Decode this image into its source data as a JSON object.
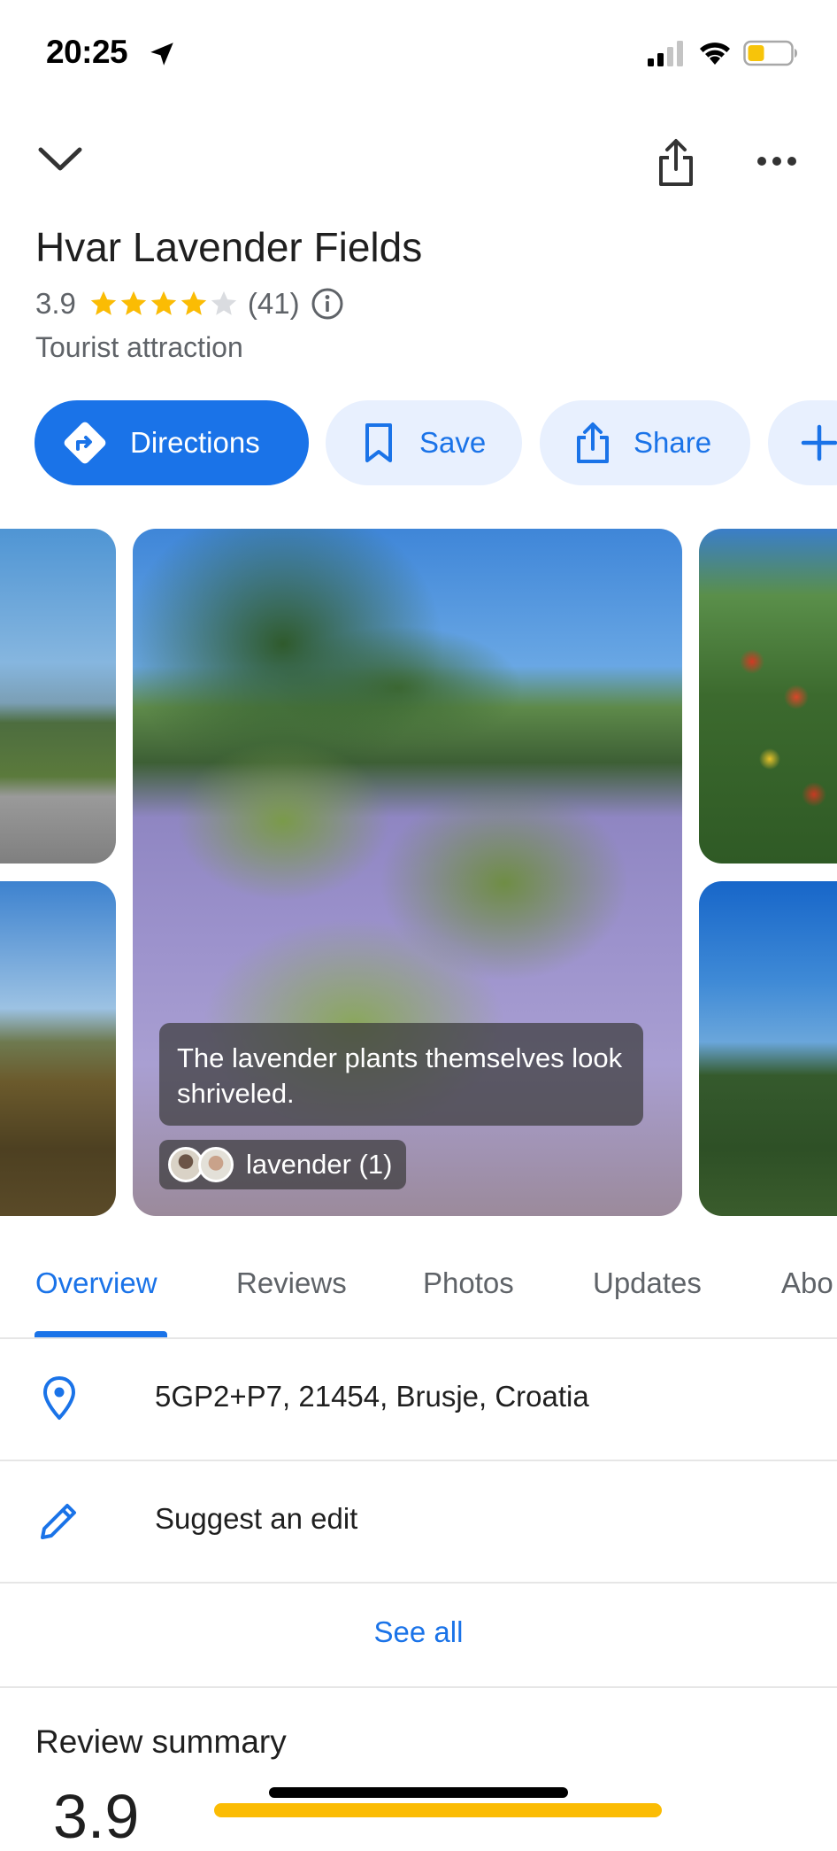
{
  "status_bar": {
    "time": "20:25"
  },
  "header": {
    "collapse_icon": "chevron-down-icon",
    "share_icon": "share-icon",
    "more_icon": "more-horizontal-icon"
  },
  "place": {
    "title": "Hvar Lavender Fields",
    "rating": "3.9",
    "rating_value": 3.9,
    "review_count": "(41)",
    "category": "Tourist attraction"
  },
  "actions": {
    "directions": "Directions",
    "save": "Save",
    "share": "Share"
  },
  "photos": {
    "caption": "The lavender plants themselves look shriveled.",
    "tag": "lavender (1)"
  },
  "tabs": [
    {
      "label": "Overview",
      "active": true
    },
    {
      "label": "Reviews"
    },
    {
      "label": "Photos"
    },
    {
      "label": "Updates"
    },
    {
      "label": "Abo"
    }
  ],
  "info": {
    "address": "5GP2+P7, 21454, Brusje, Croatia",
    "suggest_edit": "Suggest an edit",
    "see_all": "See all"
  },
  "review_summary": {
    "title": "Review summary",
    "rating": "3.9"
  },
  "colors": {
    "accent": "#1a73e8",
    "chip_bg": "#e8f0fe",
    "star": "#fbbc04"
  }
}
